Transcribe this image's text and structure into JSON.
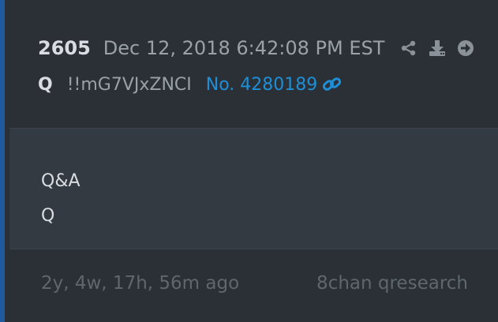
{
  "post": {
    "number": "2605",
    "timestamp": "Dec 12, 2018 6:42:08 PM EST",
    "author": "Q",
    "tripcode": "!!mG7VJxZNCI",
    "link_text": "No. 4280189",
    "message_lines": [
      "Q&A",
      "Q"
    ],
    "age": "2y, 4w, 17h, 56m ago",
    "source": "8chan qresearch"
  },
  "icons": {
    "share": "share-icon",
    "download": "download-icon",
    "goto": "arrow-circle-right-icon",
    "link": "chain-link-icon"
  },
  "colors": {
    "accent_bar": "#1f5aa0",
    "link": "#1e8fd6",
    "text_primary": "#d9dde1",
    "text_secondary": "#9aa1a8",
    "text_muted": "#5f666d",
    "background": "#2b3036",
    "message_background": "#343a41"
  }
}
